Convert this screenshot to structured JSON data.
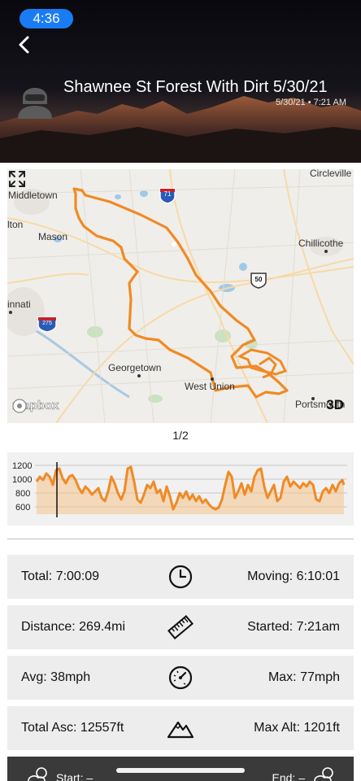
{
  "status_bar": {
    "time": "4:36"
  },
  "header": {
    "title": "Shawnee St Forest With Dirt 5/30/21",
    "date": "5/30/21 • 7:21 AM"
  },
  "map": {
    "labels": {
      "middletown": "Middletown",
      "circleville": "Circleville",
      "milton": "lton",
      "mason": "Mason",
      "chillicothe": "Chillicothe",
      "cincinnati": "innati",
      "georgetown": "Georgetown",
      "west_union": "West Union",
      "portsmouth": "Portsmouth"
    },
    "shields": {
      "i71": "71",
      "i275": "275",
      "us50": "50"
    },
    "attribution": "mapbox",
    "view_3d_label": "3D",
    "route_color": "#f08a24"
  },
  "pager": "1/2",
  "elevation_chart": {
    "y_ticks": [
      "1200",
      "1000",
      "800",
      "600"
    ],
    "line_color": "#f08a24",
    "fill_color": "#f6c28d"
  },
  "stats": [
    {
      "left": "Total: 7:00:09",
      "icon": "clock-icon",
      "right": "Moving: 6:10:01"
    },
    {
      "left": "Distance: 269.4mi",
      "icon": "ruler-icon",
      "right": "Started: 7:21am"
    },
    {
      "left": "Avg: 38mph",
      "icon": "speedometer-icon",
      "right": "Max: 77mph"
    },
    {
      "left": "Total Asc: 12557ft",
      "icon": "mountain-icon",
      "right": "Max Alt: 1201ft"
    }
  ],
  "weather": {
    "start_label": "Start: –",
    "end_label": "End: –"
  }
}
